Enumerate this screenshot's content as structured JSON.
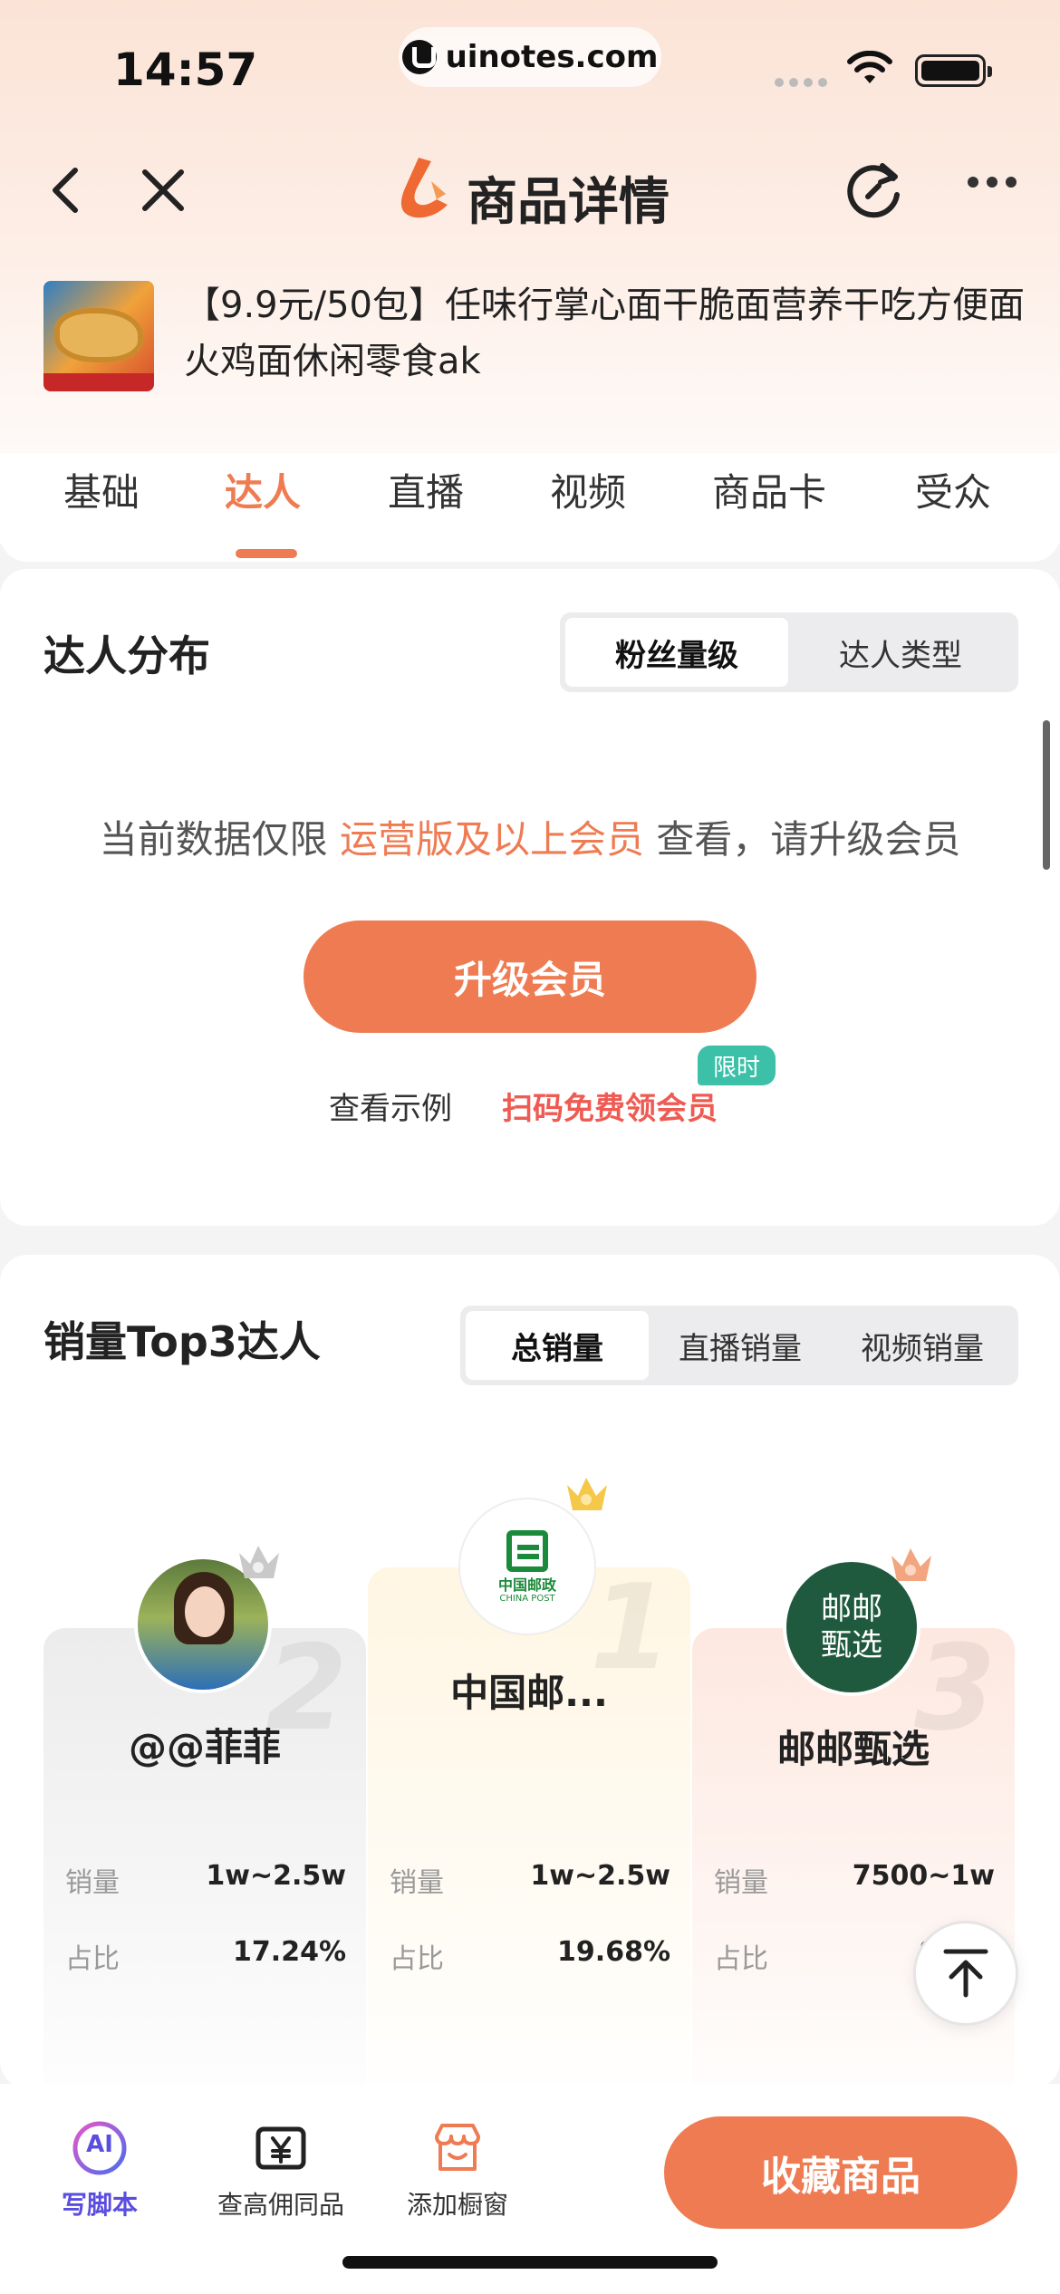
{
  "status_bar": {
    "time": "14:57",
    "url": "uinotes.com"
  },
  "nav": {
    "title": "商品详情"
  },
  "product": {
    "title": "【9.9元/50包】任味行掌心面干脆面营养干吃方便面火鸡面休闲零食ak"
  },
  "tabs": [
    "基础",
    "达人",
    "直播",
    "视频",
    "商品卡",
    "受众"
  ],
  "active_tab": "达人",
  "distribution": {
    "title": "达人分布",
    "segments": [
      "粉丝量级",
      "达人类型"
    ],
    "active_segment": "粉丝量级",
    "locked_prefix": "当前数据仅限",
    "locked_highlight": "运营版及以上会员",
    "locked_suffix": "查看，请升级会员",
    "upgrade_label": "升级会员",
    "view_example": "查看示例",
    "scan_free": "扫码免费领会员",
    "limited_badge": "限时"
  },
  "top3": {
    "title": "销量Top3达人",
    "segments": [
      "总销量",
      "直播销量",
      "视频销量"
    ],
    "active_segment": "总销量",
    "sales_label": "销量",
    "share_label": "占比",
    "ranks": [
      {
        "rank": "2",
        "name": "@@菲菲",
        "sales": "1w~2.5w",
        "share": "17.24%"
      },
      {
        "rank": "1",
        "name": "中国邮...",
        "sales": "1w~2.5w",
        "share": "19.68%"
      },
      {
        "rank": "3",
        "name": "邮邮甄选",
        "sales": "7500~1w",
        "share": "9.6%"
      }
    ],
    "post_logo_cn": "中国邮政",
    "post_logo_en": "CHINA POST",
    "green_logo": "邮邮甄选"
  },
  "bottom_bar": {
    "items": [
      {
        "label": "写脚本",
        "icon": "ai-icon"
      },
      {
        "label": "查高佣同品",
        "icon": "yen-icon"
      },
      {
        "label": "添加橱窗",
        "icon": "store-icon"
      }
    ],
    "ai_badge": "AI",
    "collect_label": "收藏商品"
  },
  "colors": {
    "accent": "#ef7b52",
    "badge": "#3cc0a8",
    "ai": "#5a4de0"
  }
}
